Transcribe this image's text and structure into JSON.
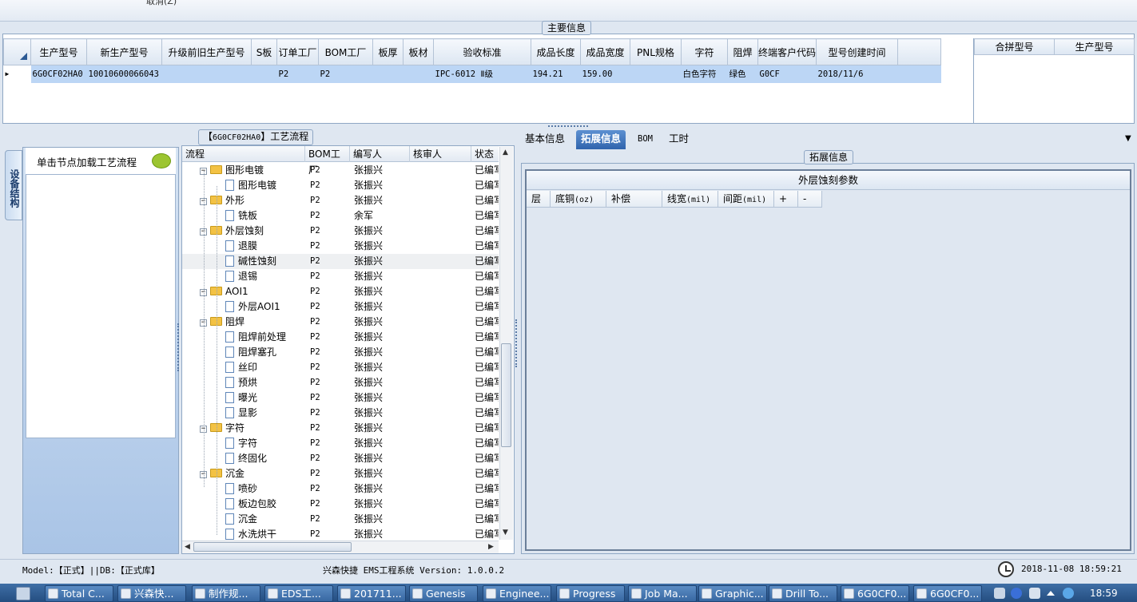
{
  "top": {
    "cancel_label": "取消(Z)"
  },
  "main_info": {
    "legend": "主要信息",
    "columns": [
      "生产型号",
      "新生产型号",
      "升级前旧生产型号",
      "S板",
      "订单工厂",
      "BOM工厂",
      "板厚",
      "板材",
      "验收标准",
      "成品长度",
      "成品宽度",
      "PNL规格",
      "字符",
      "阻焊",
      "终端客户代码",
      "型号创建时间"
    ],
    "row": [
      "6G0CF02HA0",
      "10010600066043",
      "",
      "",
      "P2",
      "P2",
      "",
      "",
      "IPC-6012 Ⅱ级",
      "194.21",
      "159.00",
      "",
      "白色字符",
      "绿色",
      "G0CF",
      "2018/11/6"
    ],
    "merge_columns": [
      "合拼型号",
      "生产型号"
    ]
  },
  "left_panel": {
    "side_tab": "设备结构",
    "hint": "单击节点加载工艺流程"
  },
  "process": {
    "legend_code": "6G0CF02HA0",
    "legend_text": "工艺流程",
    "columns": [
      "流程",
      "BOM工厂",
      "编写人",
      "核审人",
      "状态"
    ],
    "rows": [
      {
        "name": "图形电镀",
        "level": 0,
        "bom": "P2",
        "author": "张振兴",
        "reviewer": "",
        "status": "已编写"
      },
      {
        "name": "图形电镀",
        "level": 1,
        "bom": "P2",
        "author": "张振兴",
        "reviewer": "",
        "status": "已编写"
      },
      {
        "name": "外形",
        "level": 0,
        "bom": "P2",
        "author": "张振兴",
        "reviewer": "",
        "status": "已编写"
      },
      {
        "name": "铣板",
        "level": 1,
        "bom": "P2",
        "author": "余军",
        "reviewer": "",
        "status": "已编写"
      },
      {
        "name": "外层蚀刻",
        "level": 0,
        "bom": "P2",
        "author": "张振兴",
        "reviewer": "",
        "status": "已编写"
      },
      {
        "name": "退膜",
        "level": 1,
        "bom": "P2",
        "author": "张振兴",
        "reviewer": "",
        "status": "已编写"
      },
      {
        "name": "碱性蚀刻",
        "level": 1,
        "bom": "P2",
        "author": "张振兴",
        "reviewer": "",
        "status": "已编写"
      },
      {
        "name": "退锡",
        "level": 1,
        "bom": "P2",
        "author": "张振兴",
        "reviewer": "",
        "status": "已编写"
      },
      {
        "name": "AOI1",
        "level": 0,
        "bom": "P2",
        "author": "张振兴",
        "reviewer": "",
        "status": "已编写"
      },
      {
        "name": "外层AOI1",
        "level": 1,
        "bom": "P2",
        "author": "张振兴",
        "reviewer": "",
        "status": "已编写"
      },
      {
        "name": "阻焊",
        "level": 0,
        "bom": "P2",
        "author": "张振兴",
        "reviewer": "",
        "status": "已编写"
      },
      {
        "name": "阻焊前处理",
        "level": 1,
        "bom": "P2",
        "author": "张振兴",
        "reviewer": "",
        "status": "已编写"
      },
      {
        "name": "阻焊塞孔",
        "level": 1,
        "bom": "P2",
        "author": "张振兴",
        "reviewer": "",
        "status": "已编写"
      },
      {
        "name": "丝印",
        "level": 1,
        "bom": "P2",
        "author": "张振兴",
        "reviewer": "",
        "status": "已编写"
      },
      {
        "name": "预烘",
        "level": 1,
        "bom": "P2",
        "author": "张振兴",
        "reviewer": "",
        "status": "已编写"
      },
      {
        "name": "曝光",
        "level": 1,
        "bom": "P2",
        "author": "张振兴",
        "reviewer": "",
        "status": "已编写"
      },
      {
        "name": "显影",
        "level": 1,
        "bom": "P2",
        "author": "张振兴",
        "reviewer": "",
        "status": "已编写"
      },
      {
        "name": "字符",
        "level": 0,
        "bom": "P2",
        "author": "张振兴",
        "reviewer": "",
        "status": "已编写"
      },
      {
        "name": "字符",
        "level": 1,
        "bom": "P2",
        "author": "张振兴",
        "reviewer": "",
        "status": "已编写"
      },
      {
        "name": "终固化",
        "level": 1,
        "bom": "P2",
        "author": "张振兴",
        "reviewer": "",
        "status": "已编写"
      },
      {
        "name": "沉金",
        "level": 0,
        "bom": "P2",
        "author": "张振兴",
        "reviewer": "",
        "status": "已编写"
      },
      {
        "name": "喷砂",
        "level": 1,
        "bom": "P2",
        "author": "张振兴",
        "reviewer": "",
        "status": "已编写"
      },
      {
        "name": "板边包胶",
        "level": 1,
        "bom": "P2",
        "author": "张振兴",
        "reviewer": "",
        "status": "已编写"
      },
      {
        "name": "沉金",
        "level": 1,
        "bom": "P2",
        "author": "张振兴",
        "reviewer": "",
        "status": "已编写"
      },
      {
        "name": "水洗烘干",
        "level": 1,
        "bom": "P2",
        "author": "张振兴",
        "reviewer": "",
        "status": "已编写"
      }
    ]
  },
  "right_panel": {
    "tabs": [
      "基本信息",
      "拓展信息",
      "BOM",
      "工时"
    ],
    "active_tab": "拓展信息",
    "legend": "拓展信息",
    "param_title": "外层蚀刻参数",
    "param_columns": [
      {
        "label": "层",
        "unit": ""
      },
      {
        "label": "底铜",
        "unit": "(oz)"
      },
      {
        "label": "补偿",
        "unit": ""
      },
      {
        "label": "线宽",
        "unit": "(mil)"
      },
      {
        "label": "间距",
        "unit": "(mil)"
      },
      {
        "label": "+",
        "unit": ""
      },
      {
        "label": "-",
        "unit": ""
      }
    ]
  },
  "status_bar": {
    "left": "Model:【正式】||DB:【正式库】",
    "center": "兴森快捷 EMS工程系统 Version: 1.0.0.2",
    "time": "2018-11-08 18:59:21"
  },
  "taskbar": {
    "items": [
      "Total C...",
      "兴森快...",
      "制作规...",
      "EDS工...",
      "201711...",
      "Genesis",
      "Enginee...",
      "Progress",
      "Job Ma...",
      "Graphic...",
      "Drill To...",
      "6G0CF0...",
      "6G0CF0..."
    ],
    "clock": "18:59"
  },
  "colors": {
    "selected_row": "#bcd6f5",
    "active_tab": "#2f64ad",
    "taskbar": "#2f5a8e",
    "frame": "#dfe7f1"
  }
}
